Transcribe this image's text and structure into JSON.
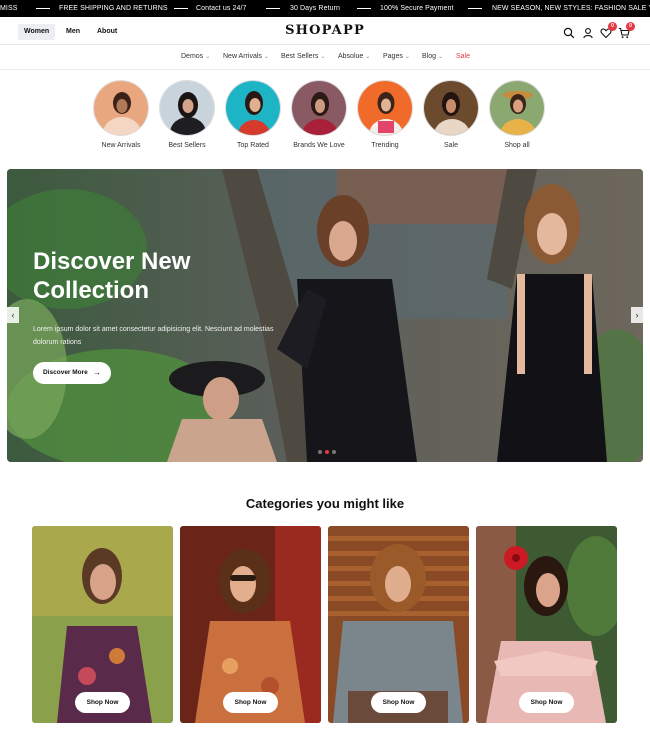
{
  "announcements": [
    "MISS",
    "FREE SHIPPING AND RETURNS",
    "Contact us 24/7",
    "30 Days Return",
    "100% Secure Payment",
    "NEW SEASON, NEW STYLES: FASHION SALE YOU CAN"
  ],
  "header": {
    "gender_tabs": [
      "Women",
      "Men",
      "About"
    ],
    "active_tab": "Women",
    "logo": "SHOPAPP",
    "wishlist_count": "0",
    "cart_count": "0",
    "icons": [
      "search-icon",
      "user-icon",
      "heart-icon",
      "cart-icon"
    ]
  },
  "nav": {
    "items": [
      "Demos",
      "New Arrivals",
      "Best Sellers",
      "Absolue",
      "Pages",
      "Blog",
      "Sale"
    ],
    "sale_color": "#e63946"
  },
  "circle_categories": [
    "New Arrivals",
    "Best Sellers",
    "Top Rated",
    "Brands We Love",
    "Trending",
    "Sale",
    "Shop all"
  ],
  "hero": {
    "title": "Discover New Collection",
    "subtitle": "Lorem ipsum dolor sit amet consectetur adipisicing elit. Nesciunt ad molestias dolorum rations",
    "button_label": "Discover More",
    "slide_count": 3,
    "active_slide": 1
  },
  "categories_section": {
    "title": "Categories you might like",
    "cards": [
      {
        "button_label": "Shop Now"
      },
      {
        "button_label": "Shop Now"
      },
      {
        "button_label": "Shop Now"
      },
      {
        "button_label": "Shop Now"
      }
    ]
  },
  "colors": {
    "ticker_bg": "#000000",
    "badge": "#e63946",
    "accent": "#e63946"
  }
}
